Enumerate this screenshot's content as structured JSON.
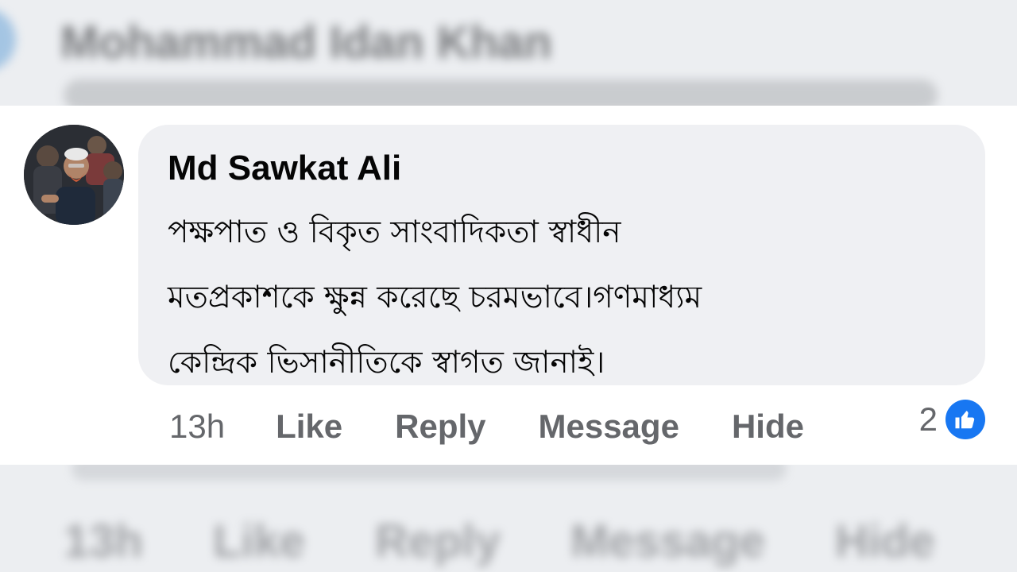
{
  "background_comment": {
    "author": "Mohammad Idan Khan",
    "actions": [
      "13h",
      "Like",
      "Reply",
      "Message",
      "Hide"
    ]
  },
  "comment": {
    "author": "Md Sawkat Ali",
    "text_lines": [
      "পক্ষপাত ও বিকৃত সাংবাদিকতা স্বাধীন",
      "মতপ্রকাশকে ক্ষুন্ন করেছে চরমভাবে।গণমাধ্যম",
      "কেন্দ্রিক ভিসানীতিকে স্বাগত জানাই।"
    ],
    "time": "13h",
    "like_label": "Like",
    "reply_label": "Reply",
    "message_label": "Message",
    "hide_label": "Hide",
    "reaction_count": "2",
    "reaction_icon": "thumbs-up-icon",
    "colors": {
      "like_blue": "#1877f2",
      "bubble": "#eff0f3",
      "meta_text": "#65676b"
    }
  }
}
